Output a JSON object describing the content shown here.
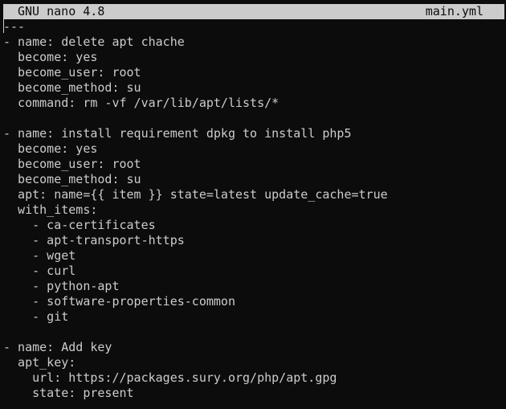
{
  "titlebar": {
    "app": "GNU nano 4.8",
    "filename": "main.yml"
  },
  "buffer": {
    "lines": [
      "---",
      "- name: delete apt chache",
      "  become: yes",
      "  become_user: root",
      "  become_method: su",
      "  command: rm -vf /var/lib/apt/lists/*",
      "",
      "- name: install requirement dpkg to install php5",
      "  become: yes",
      "  become_user: root",
      "  become_method: su",
      "  apt: name={{ item }} state=latest update_cache=true",
      "  with_items:",
      "    - ca-certificates",
      "    - apt-transport-https",
      "    - wget",
      "    - curl",
      "    - python-apt",
      "    - software-properties-common",
      "    - git",
      "",
      "- name: Add key",
      "  apt_key:",
      "    url: https://packages.sury.org/php/apt.gpg",
      "    state: present"
    ]
  },
  "colors": {
    "background": "#0c0c0c",
    "foreground": "#cccccc",
    "titlebar_bg": "#cccccc",
    "titlebar_fg": "#0c0c0c"
  }
}
